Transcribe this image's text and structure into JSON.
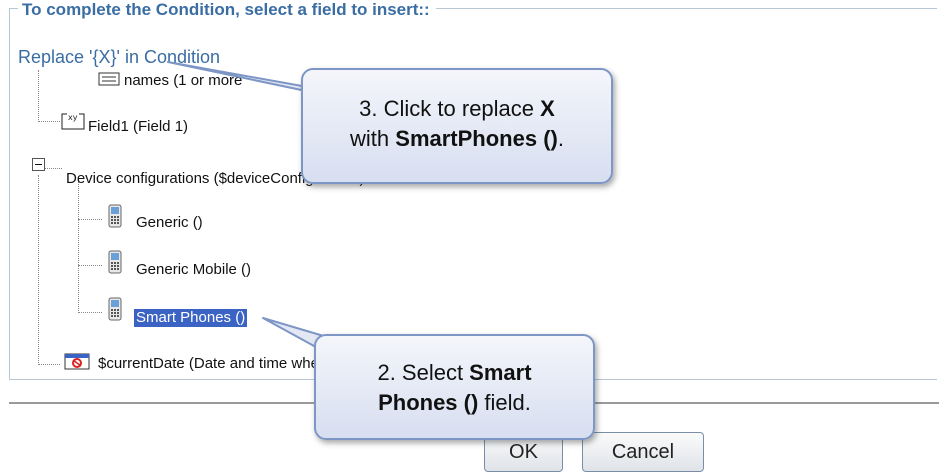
{
  "fieldset": {
    "legend": "To complete the Condition, select a field to insert::",
    "replace_link": "Replace '{X}' in Condition"
  },
  "tree": {
    "partial_item": "names (1 or more",
    "field1": "Field1 (Field 1)",
    "device_configurations": "Device configurations ($deviceConfiguration)",
    "generic": "Generic ()",
    "generic_mobile": "Generic Mobile ()",
    "smart_phones": "Smart Phones ()",
    "current_date": "$currentDate (Date and time when the rule is evaluated)"
  },
  "icons": {
    "list": "list-icon",
    "field": "xy-field-icon",
    "minus": "minus-box-icon",
    "phone": "phone-icon",
    "calendar": "calendar-icon"
  },
  "callout_top": {
    "line1_prefix": "3. Click to replace ",
    "line1_bold": "X",
    "line2_prefix": "with ",
    "line2_bold": "SmartPhones ()",
    "line2_suffix": "."
  },
  "callout_bottom": {
    "line1_prefix": "2. Select ",
    "line1_bold": "Smart",
    "line2_bold": "Phones ()",
    "line2_suffix": " field."
  },
  "buttons": {
    "ok": "OK",
    "cancel": "Cancel"
  },
  "colors": {
    "accent": "#3a6da3",
    "selection": "#3b63c4",
    "callout_border": "#7d96c6"
  }
}
